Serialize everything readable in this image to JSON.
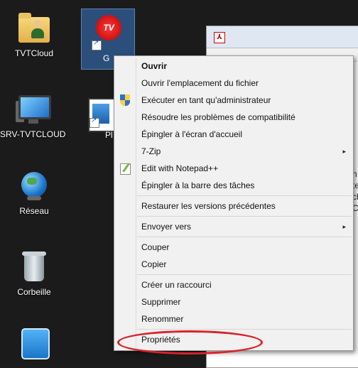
{
  "desktop": {
    "icons": [
      {
        "label": "TVTCloud"
      },
      {
        "label": "G"
      },
      {
        "label": "SRV-TVTCLOUD"
      },
      {
        "label": "Pl"
      },
      {
        "label": "Réseau"
      },
      {
        "label": "Corbeille"
      },
      {
        "label": ""
      }
    ],
    "tvtools_logo_text": "TV"
  },
  "context_menu": {
    "items": [
      {
        "label": "Ouvrir",
        "bold": true
      },
      {
        "label": "Ouvrir l'emplacement du fichier"
      },
      {
        "label": "Exécuter en tant qu'administrateur",
        "icon": "uac-shield-icon"
      },
      {
        "label": "Résoudre les problèmes de compatibilité"
      },
      {
        "label": "Épingler à l'écran d'accueil"
      },
      {
        "label": "7-Zip",
        "submenu": true
      },
      {
        "label": "Edit with Notepad++",
        "icon": "notepad-plus-plus-icon"
      },
      {
        "label": "Épingler à la barre des tâches"
      },
      {
        "label": "Restaurer les versions précédentes"
      },
      {
        "label": "Envoyer vers",
        "submenu": true
      },
      {
        "label": "Couper"
      },
      {
        "label": "Copier"
      },
      {
        "label": "Créer un raccourci"
      },
      {
        "label": "Supprimer"
      },
      {
        "label": "Renommer"
      },
      {
        "label": "Propriétés"
      }
    ],
    "submenu_arrow": "▸"
  },
  "behind_window": {
    "pdf_glyph": "⅄",
    "side_text": [
      "n",
      "te",
      "cl",
      "C"
    ]
  },
  "colors": {
    "highlight": "#d9232b",
    "menu_bg": "#f1f1f1",
    "desktop_bg": "#1b1b1b"
  }
}
